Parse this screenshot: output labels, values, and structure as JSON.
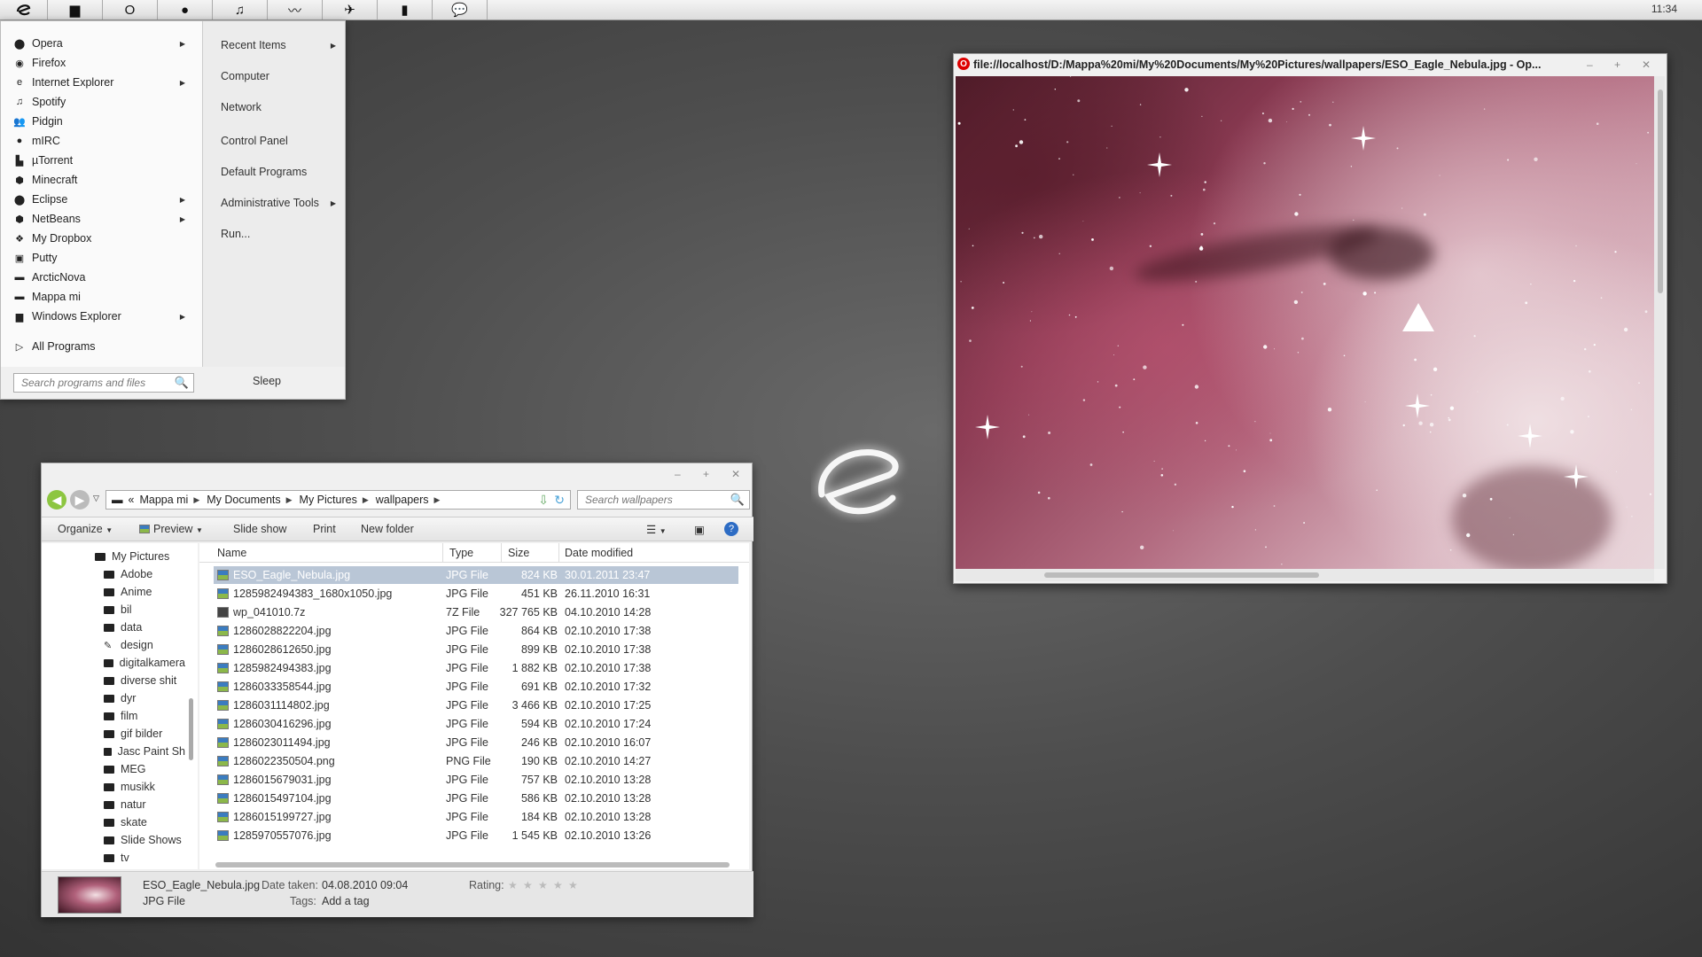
{
  "taskbar": {
    "buttons": [
      "start",
      "explorer",
      "opera",
      "firefox",
      "spotify",
      "pidgin",
      "utorrent",
      "dropbox",
      "chat"
    ],
    "clock": "11:34"
  },
  "startmenu": {
    "left_items": [
      {
        "label": "Opera",
        "icon": "opera-icon",
        "submenu": true
      },
      {
        "label": "Firefox",
        "icon": "firefox-icon",
        "submenu": false
      },
      {
        "label": "Internet Explorer",
        "icon": "ie-icon",
        "submenu": true
      },
      {
        "label": "Spotify",
        "icon": "spotify-icon",
        "submenu": false
      },
      {
        "label": "Pidgin",
        "icon": "pidgin-icon",
        "submenu": false
      },
      {
        "label": "mIRC",
        "icon": "mirc-icon",
        "submenu": false
      },
      {
        "label": "µTorrent",
        "icon": "utorrent-icon",
        "submenu": false
      },
      {
        "label": "Minecraft",
        "icon": "minecraft-icon",
        "submenu": false
      },
      {
        "label": "Eclipse",
        "icon": "eclipse-icon",
        "submenu": true
      },
      {
        "label": "NetBeans",
        "icon": "netbeans-icon",
        "submenu": true
      },
      {
        "label": "My Dropbox",
        "icon": "dropbox-icon",
        "submenu": false
      },
      {
        "label": "Putty",
        "icon": "putty-icon",
        "submenu": false
      },
      {
        "label": "ArcticNova",
        "icon": "folder-icon",
        "submenu": false
      },
      {
        "label": "Mappa mi",
        "icon": "folder-icon",
        "submenu": false
      },
      {
        "label": "Windows Explorer",
        "icon": "explorer-icon",
        "submenu": true
      }
    ],
    "all_programs": "All Programs",
    "right_items": [
      {
        "label": "Recent Items",
        "submenu": true
      },
      {
        "label": "Computer",
        "submenu": false
      },
      {
        "label": "Network",
        "submenu": false
      },
      {
        "label": "Control Panel",
        "submenu": false
      },
      {
        "label": "Default Programs",
        "submenu": false
      },
      {
        "label": "Administrative Tools",
        "submenu": true
      },
      {
        "label": "Run...",
        "submenu": false
      }
    ],
    "search_placeholder": "Search programs and files",
    "sleep": "Sleep"
  },
  "explorer": {
    "breadcrumb": [
      "«",
      "Mappa mi",
      "My Documents",
      "My Pictures",
      "wallpapers"
    ],
    "search_placeholder": "Search wallpapers",
    "commands": [
      "Organize",
      "Preview",
      "Slide show",
      "Print",
      "New folder"
    ],
    "tree": {
      "root": "My Pictures",
      "items": [
        "Adobe",
        "Anime",
        "bil",
        "data",
        "design",
        "digitalkamera",
        "diverse shit",
        "dyr",
        "film",
        "gif bilder",
        "Jasc Paint Sh",
        "MEG",
        "musikk",
        "natur",
        "skate",
        "Slide Shows",
        "tv"
      ]
    },
    "columns": [
      "Name",
      "Type",
      "Size",
      "Date modified"
    ],
    "files": [
      {
        "name": "ESO_Eagle_Nebula.jpg",
        "type": "JPG File",
        "size": "824 KB",
        "date": "30.01.2011 23:47",
        "selected": true
      },
      {
        "name": "1285982494383_1680x1050.jpg",
        "type": "JPG File",
        "size": "451 KB",
        "date": "26.11.2010 16:31"
      },
      {
        "name": "wp_041010.7z",
        "type": "7Z File",
        "size": "327 765 KB",
        "date": "04.10.2010 14:28"
      },
      {
        "name": "1286028822204.jpg",
        "type": "JPG File",
        "size": "864 KB",
        "date": "02.10.2010 17:38"
      },
      {
        "name": "1286028612650.jpg",
        "type": "JPG File",
        "size": "899 KB",
        "date": "02.10.2010 17:38"
      },
      {
        "name": "1285982494383.jpg",
        "type": "JPG File",
        "size": "1 882 KB",
        "date": "02.10.2010 17:38"
      },
      {
        "name": "1286033358544.jpg",
        "type": "JPG File",
        "size": "691 KB",
        "date": "02.10.2010 17:32"
      },
      {
        "name": "1286031114802.jpg",
        "type": "JPG File",
        "size": "3 466 KB",
        "date": "02.10.2010 17:25"
      },
      {
        "name": "1286030416296.jpg",
        "type": "JPG File",
        "size": "594 KB",
        "date": "02.10.2010 17:24"
      },
      {
        "name": "1286023011494.jpg",
        "type": "JPG File",
        "size": "246 KB",
        "date": "02.10.2010 16:07"
      },
      {
        "name": "1286022350504.png",
        "type": "PNG File",
        "size": "190 KB",
        "date": "02.10.2010 14:27"
      },
      {
        "name": "1286015679031.jpg",
        "type": "JPG File",
        "size": "757 KB",
        "date": "02.10.2010 13:28"
      },
      {
        "name": "1286015497104.jpg",
        "type": "JPG File",
        "size": "586 KB",
        "date": "02.10.2010 13:28"
      },
      {
        "name": "1286015199727.jpg",
        "type": "JPG File",
        "size": "184 KB",
        "date": "02.10.2010 13:28"
      },
      {
        "name": "1285970557076.jpg",
        "type": "JPG File",
        "size": "1 545 KB",
        "date": "02.10.2010 13:26"
      }
    ],
    "details": {
      "filename": "ESO_Eagle_Nebula.jpg",
      "filetype": "JPG File",
      "date_taken_label": "Date taken:",
      "date_taken": "04.08.2010 09:04",
      "tags_label": "Tags:",
      "tags": "Add a tag",
      "rating_label": "Rating:"
    }
  },
  "opera": {
    "title": "file://localhost/D:/Mappa%20mi/My%20Documents/My%20Pictures/wallpapers/ESO_Eagle_Nebula.jpg - Op..."
  }
}
